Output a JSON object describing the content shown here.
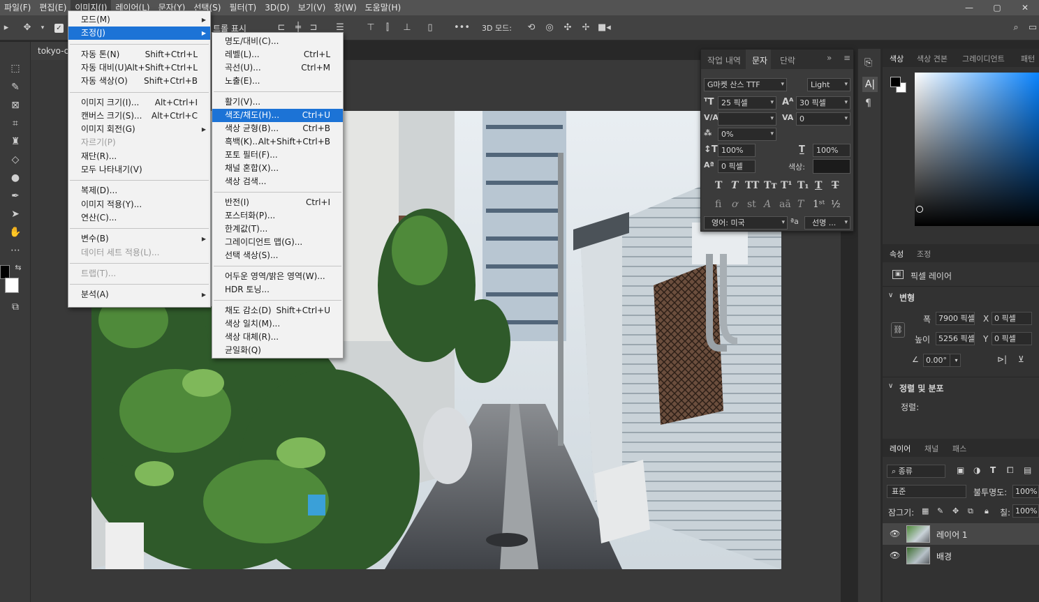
{
  "menubar": {
    "items": [
      "파일(F)",
      "편집(E)",
      "이미지(I)",
      "레이어(L)",
      "문자(Y)",
      "선택(S)",
      "필터(T)",
      "3D(D)",
      "보기(V)",
      "창(W)",
      "도움말(H)"
    ],
    "active_index": 2
  },
  "window_controls": {
    "minimize": "—",
    "maximize": "▢",
    "close": "✕"
  },
  "optbar": {
    "show_controls": "트롤 표시",
    "mode3d": "3D 모드:"
  },
  "document": {
    "tab_title": "tokyo-ci"
  },
  "image_menu": {
    "items": [
      {
        "label": "모드(M)",
        "shortcut": "",
        "submenu": true
      },
      {
        "label": "조정(J)",
        "shortcut": "",
        "submenu": true,
        "highlighted": true
      },
      {
        "label": "자동 톤(N)",
        "shortcut": "Shift+Ctrl+L"
      },
      {
        "label": "자동 대비(U)",
        "shortcut": "Alt+Shift+Ctrl+L"
      },
      {
        "label": "자동 색상(O)",
        "shortcut": "Shift+Ctrl+B"
      },
      {
        "label": "이미지 크기(I)...",
        "shortcut": "Alt+Ctrl+I"
      },
      {
        "label": "캔버스 크기(S)...",
        "shortcut": "Alt+Ctrl+C"
      },
      {
        "label": "이미지 회전(G)",
        "shortcut": "",
        "submenu": true
      },
      {
        "label": "자르기(P)",
        "shortcut": "",
        "disabled": true
      },
      {
        "label": "재단(R)...",
        "shortcut": ""
      },
      {
        "label": "모두 나타내기(V)",
        "shortcut": ""
      },
      {
        "label": "복제(D)...",
        "shortcut": ""
      },
      {
        "label": "이미지 적용(Y)...",
        "shortcut": ""
      },
      {
        "label": "연산(C)...",
        "shortcut": ""
      },
      {
        "label": "변수(B)",
        "shortcut": "",
        "submenu": true
      },
      {
        "label": "데이터 세트 적용(L)...",
        "shortcut": "",
        "disabled": true
      },
      {
        "label": "트랩(T)...",
        "shortcut": "",
        "disabled": true
      },
      {
        "label": "분석(A)",
        "shortcut": "",
        "submenu": true
      }
    ]
  },
  "adjust_menu": {
    "items": [
      {
        "label": "명도/대비(C)...",
        "shortcut": ""
      },
      {
        "label": "레벨(L)...",
        "shortcut": "Ctrl+L"
      },
      {
        "label": "곡선(U)...",
        "shortcut": "Ctrl+M"
      },
      {
        "label": "노출(E)...",
        "shortcut": ""
      },
      {
        "label": "활기(V)...",
        "shortcut": ""
      },
      {
        "label": "색조/채도(H)...",
        "shortcut": "Ctrl+U",
        "highlighted": true
      },
      {
        "label": "색상 균형(B)...",
        "shortcut": "Ctrl+B"
      },
      {
        "label": "흑백(K)...",
        "shortcut": "Alt+Shift+Ctrl+B"
      },
      {
        "label": "포토 필터(F)...",
        "shortcut": ""
      },
      {
        "label": "채널 혼합(X)...",
        "shortcut": ""
      },
      {
        "label": "색상 검색...",
        "shortcut": ""
      },
      {
        "label": "반전(I)",
        "shortcut": "Ctrl+I"
      },
      {
        "label": "포스터화(P)...",
        "shortcut": ""
      },
      {
        "label": "한계값(T)...",
        "shortcut": ""
      },
      {
        "label": "그레이디언트 맵(G)...",
        "shortcut": ""
      },
      {
        "label": "선택 색상(S)...",
        "shortcut": ""
      },
      {
        "label": "어두운 영역/밝은 영역(W)...",
        "shortcut": ""
      },
      {
        "label": "HDR 토닝...",
        "shortcut": ""
      },
      {
        "label": "채도 감소(D)",
        "shortcut": "Shift+Ctrl+U"
      },
      {
        "label": "색상 일치(M)...",
        "shortcut": ""
      },
      {
        "label": "색상 대체(R)...",
        "shortcut": ""
      },
      {
        "label": "균일화(Q)",
        "shortcut": ""
      }
    ]
  },
  "char_panel": {
    "tabs": [
      "작업 내역",
      "문자",
      "단락"
    ],
    "active_tab": 1,
    "font_family": "G마켓 산스 TTF",
    "font_style": "Light",
    "size": "25 픽셀",
    "leading": "30 픽셀",
    "kerning": "",
    "tracking": "0",
    "scale_ratio": "0%",
    "vscale": "100%",
    "hscale": "100%",
    "baseline": "0 픽셀",
    "color_label": "색상:",
    "color_swatch": "#1b1b1b",
    "language": "영어: 미국",
    "antialias_icon": "ªa",
    "antialias": "선명 ..."
  },
  "right_panel": {
    "color_tabs": [
      "색상",
      "색상 견본",
      "그레이디언트",
      "패턴"
    ],
    "props_tabs": [
      "속성",
      "조정"
    ],
    "pixel_layer": "픽셀 레이어",
    "transform_title": "변형",
    "w_label": "폭",
    "w_value": "7900 픽셀",
    "h_label": "높이",
    "h_value": "5256 픽셀",
    "x_label": "X",
    "x_value": "0 픽셀",
    "y_label": "Y",
    "y_value": "0 픽셀",
    "angle_value": "0.00°",
    "align_title": "정렬 및 분포",
    "align_label": "정렬:",
    "layer_tabs": [
      "레이어",
      "채널",
      "패스"
    ],
    "kind_filter": "종류",
    "blend_mode": "표준",
    "opacity_label": "불투명도:",
    "opacity_value": "100%",
    "lock_label": "잠그기:",
    "fill_label": "칠:",
    "fill_value": "100%",
    "layers": [
      "레이어 1",
      "배경"
    ]
  },
  "colors": {
    "menu_highlight": "#1c73d6",
    "foreground": "#000000",
    "background": "#ffffff",
    "picker_hue": "#0a84ff"
  }
}
